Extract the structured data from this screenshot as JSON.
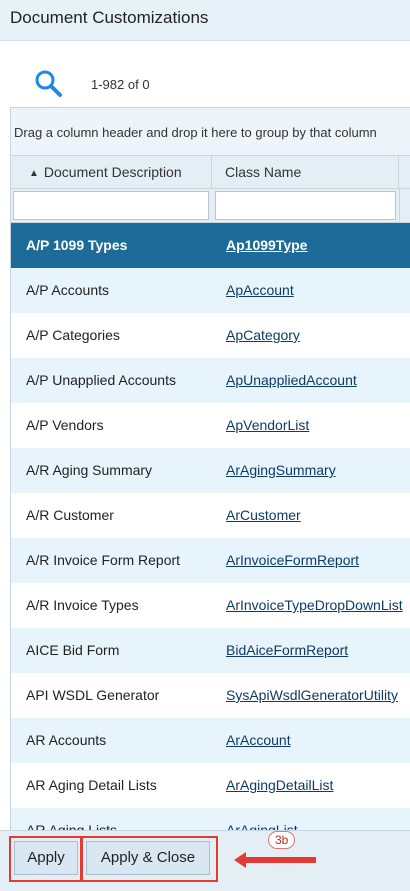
{
  "window": {
    "title": "Document Customizations"
  },
  "toolbar": {
    "search_icon": "search-icon",
    "pager_info": "1-982 of 0"
  },
  "grid": {
    "group_panel_text": "Drag a column header and drop it here to group by that column",
    "columns": [
      {
        "label": "Document Description",
        "sort": "ascending"
      },
      {
        "label": "Class Name"
      }
    ],
    "filters": [
      "",
      ""
    ],
    "rows": [
      {
        "description": "A/P 1099 Types",
        "class_name": "Ap1099Type",
        "selected": true
      },
      {
        "description": "A/P Accounts",
        "class_name": "ApAccount"
      },
      {
        "description": "A/P Categories",
        "class_name": "ApCategory"
      },
      {
        "description": "A/P Unapplied Accounts",
        "class_name": "ApUnappliedAccount"
      },
      {
        "description": "A/P Vendors",
        "class_name": "ApVendorList"
      },
      {
        "description": "A/R Aging Summary",
        "class_name": "ArAgingSummary"
      },
      {
        "description": "A/R Customer",
        "class_name": "ArCustomer"
      },
      {
        "description": "A/R Invoice Form Report",
        "class_name": "ArInvoiceFormReport"
      },
      {
        "description": "A/R Invoice Types",
        "class_name": "ArInvoiceTypeDropDownList"
      },
      {
        "description": "AICE Bid Form",
        "class_name": "BidAiceFormReport"
      },
      {
        "description": "API WSDL Generator",
        "class_name": "SysApiWsdlGeneratorUtility"
      },
      {
        "description": "AR Accounts",
        "class_name": "ArAccount"
      },
      {
        "description": "AR Aging Detail Lists",
        "class_name": "ArAgingDetailList"
      },
      {
        "description": "AR Aging Lists",
        "class_name": "ArAgingList"
      }
    ]
  },
  "footer": {
    "apply_label": "Apply",
    "apply_close_label": "Apply & Close",
    "annotation_label": "3b"
  },
  "colors": {
    "selected_row": "#1d6b99",
    "alt_row": "#e7f4fb",
    "highlight": "#e53935",
    "link": "#0d3b66"
  }
}
